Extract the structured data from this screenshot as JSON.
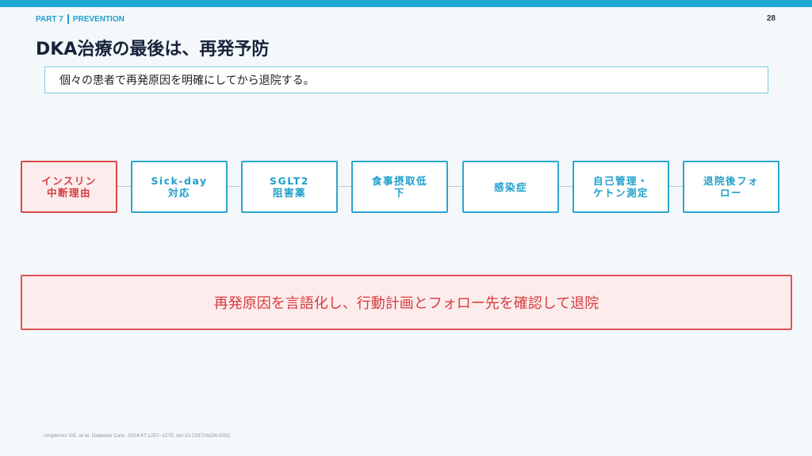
{
  "header": {
    "part": "PART 7",
    "section": "PREVENTION",
    "page_number": "28"
  },
  "title": "DKA治療の最後は、再発予防",
  "subtitle": "個々の患者で再発原因を明確にしてから退院する。",
  "flow": {
    "steps": [
      {
        "line1": "インスリン",
        "line2": "中断理由"
      },
      {
        "line1": "Sick-day",
        "line2": "対応"
      },
      {
        "line1": "SGLT2",
        "line2": "阻害薬"
      },
      {
        "line1": "食事摂取低",
        "line2": "下"
      },
      {
        "line1": "感染症",
        "line2": ""
      },
      {
        "line1": "自己管理・",
        "line2": "ケトン測定"
      },
      {
        "line1": "退院後フォ",
        "line2": "ロー"
      }
    ]
  },
  "conclusion": "再発原因を言語化し、行動計画とフォロー先を確認して退院",
  "citation": "Umpierrez GE, et al. Diabetes Care. 2024;47:1257–1275. doi:10.2337/dci24-0032",
  "colors": {
    "accent": "#1fa9d2",
    "alert": "#d63c3e",
    "alert_bg": "#fdecec"
  }
}
